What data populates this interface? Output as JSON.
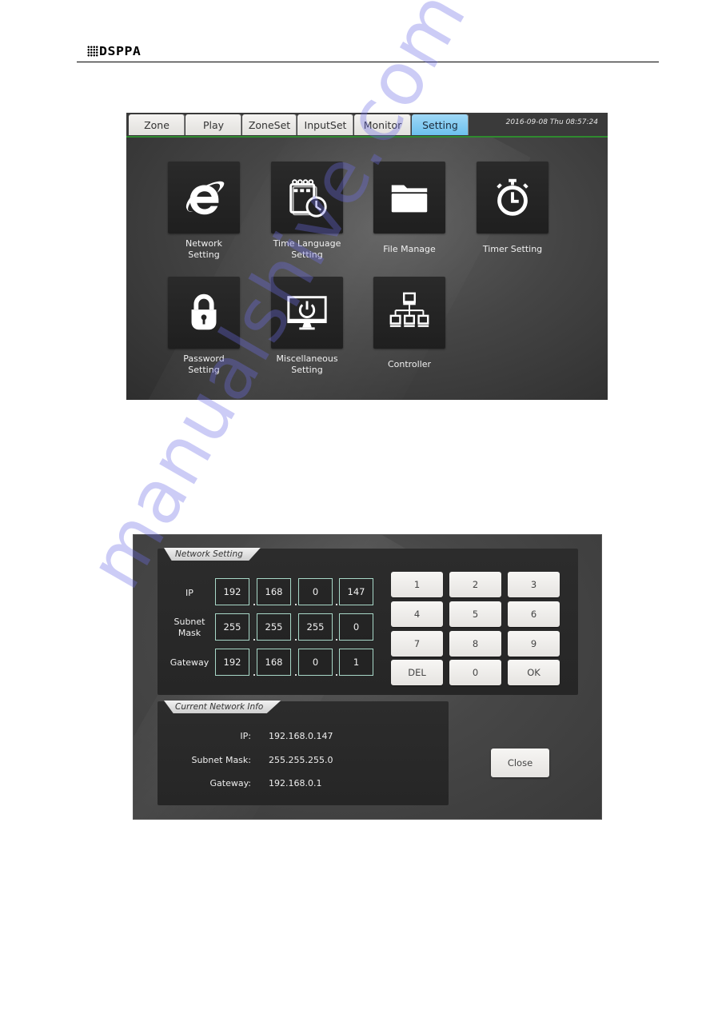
{
  "header": {
    "logo_text": "DSPPA"
  },
  "screen1": {
    "tabs": [
      {
        "label": "Zone",
        "active": false
      },
      {
        "label": "Play",
        "active": false
      },
      {
        "label": "ZoneSet",
        "active": false
      },
      {
        "label": "InputSet",
        "active": false
      },
      {
        "label": "Monitor",
        "active": false
      },
      {
        "label": "Setting",
        "active": true
      }
    ],
    "datetime": "2016-09-08 Thu 08:57:24",
    "tiles": [
      {
        "icon": "internet-explorer-icon",
        "label_line1": "Network",
        "label_line2": "Setting"
      },
      {
        "icon": "calendar-clock-icon",
        "label_line1": "Time Language",
        "label_line2": "Setting"
      },
      {
        "icon": "folder-icon",
        "label_line1": "File Manage",
        "label_line2": ""
      },
      {
        "icon": "stopwatch-icon",
        "label_line1": "Timer Setting",
        "label_line2": ""
      },
      {
        "icon": "padlock-icon",
        "label_line1": "Password",
        "label_line2": "Setting"
      },
      {
        "icon": "monitor-power-icon",
        "label_line1": "Miscellaneous",
        "label_line2": "Setting"
      },
      {
        "icon": "network-hierarchy-icon",
        "label_line1": "Controller",
        "label_line2": ""
      }
    ]
  },
  "screen2": {
    "network_setting": {
      "title": "Network Setting",
      "rows": [
        {
          "label_line1": "IP",
          "label_line2": "",
          "octets": [
            "192",
            "168",
            "0",
            "147"
          ]
        },
        {
          "label_line1": "Subnet",
          "label_line2": "Mask",
          "octets": [
            "255",
            "255",
            "255",
            "0"
          ]
        },
        {
          "label_line1": "Gateway",
          "label_line2": "",
          "octets": [
            "192",
            "168",
            "0",
            "1"
          ]
        }
      ],
      "keypad": [
        "1",
        "2",
        "3",
        "4",
        "5",
        "6",
        "7",
        "8",
        "9",
        "DEL",
        "0",
        "OK"
      ]
    },
    "current_info": {
      "title": "Current Network Info",
      "items": [
        {
          "label": "IP:",
          "value": "192.168.0.147"
        },
        {
          "label": "Subnet Mask:",
          "value": "255.255.255.0"
        },
        {
          "label": "Gateway:",
          "value": "192.168.0.1"
        }
      ]
    },
    "close_label": "Close"
  },
  "watermark": "manualshive.com",
  "colors": {
    "active_tab": "#7cc8f0",
    "tab_underline": "#2f8a2f",
    "octet_border": "#a8d8c8"
  }
}
